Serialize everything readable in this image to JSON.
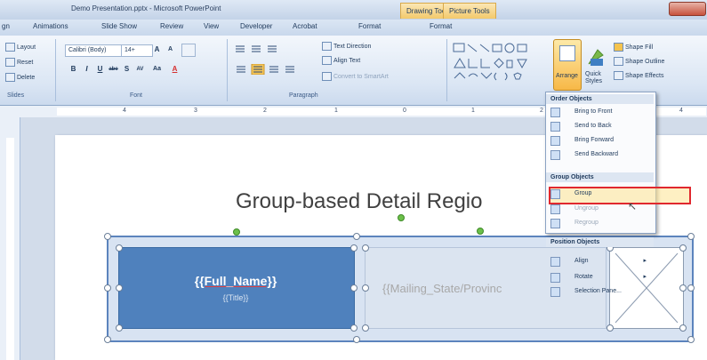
{
  "window": {
    "title": "Demo Presentation.pptx - Microsoft PowerPoint",
    "contextual_tabs": [
      "Drawing Tools",
      "Picture Tools"
    ]
  },
  "tabs": [
    "gn",
    "Animations",
    "Slide Show",
    "Review",
    "View",
    "Developer",
    "Acrobat",
    "Format",
    "Format"
  ],
  "ribbon": {
    "slides": {
      "layout": "Layout",
      "reset": "Reset",
      "delete": "Delete",
      "label": "Slides"
    },
    "font": {
      "family": "Calibri (Body)",
      "size": "14+",
      "grow": "A",
      "shrink": "A",
      "label": "Font",
      "bold": "B",
      "italic": "I",
      "underline": "U",
      "strike": "abe",
      "shadow": "S",
      "spacing": "AV",
      "case": "Aa",
      "color": "A"
    },
    "paragraph": {
      "text_direction": "Text Direction",
      "align_text": "Align Text",
      "convert_smartart": "Convert to SmartArt",
      "label": "Paragraph"
    },
    "drawing": {
      "arrange": "Arrange",
      "quick_styles": "Quick Styles",
      "shape_fill": "Shape Fill",
      "shape_outline": "Shape Outline",
      "shape_effects": "Shape Effects"
    }
  },
  "ruler": {
    "top_numbers": [
      "4",
      "3",
      "2",
      "1",
      "0",
      "1",
      "2",
      "4"
    ]
  },
  "slide": {
    "title": "Group-based Detail Regio",
    "name_placeholder": "{{Full_Name}}",
    "title_placeholder": "{{Title}}",
    "mail_placeholder": "{{Mailing_State/Provinc"
  },
  "arrange_menu": {
    "order_header": "Order Objects",
    "order_items": [
      "Bring to Front",
      "Send to Back",
      "Bring Forward",
      "Send Backward"
    ],
    "group_header": "Group Objects",
    "group_items": [
      "Group",
      "Ungroup",
      "Regroup"
    ],
    "position_header": "Position Objects",
    "position_items": [
      "Align",
      "Rotate",
      "Selection Pane..."
    ]
  },
  "colors": {
    "accent_blue": "#4f81bd",
    "highlight_red": "#e0282e",
    "ribbon_bg": "#dbe6f4"
  }
}
